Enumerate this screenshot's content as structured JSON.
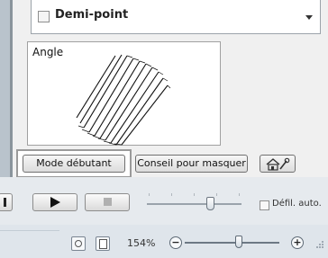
{
  "dropdown": {
    "label": "Demi-point"
  },
  "preview": {
    "title": "Angle"
  },
  "buttons": {
    "beginner_mode": "Mode débutant",
    "hide_advice": "Conseil pour masquer"
  },
  "player": {
    "auto_scroll_label": "Défil. auto.",
    "auto_scroll_checked": false
  },
  "statusbar": {
    "zoom_level": "154%"
  }
}
